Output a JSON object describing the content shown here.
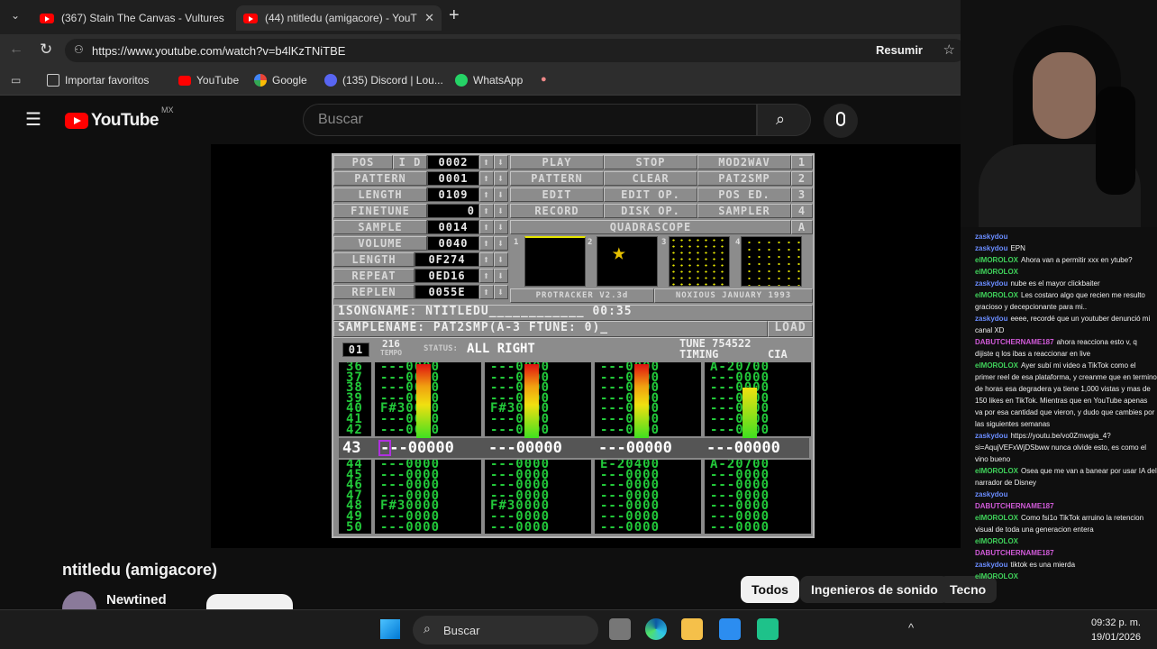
{
  "browser": {
    "tabs": [
      {
        "label": "(367) Stain The Canvas - Vultures (",
        "active": false
      },
      {
        "label": "(44) ntitledu (amigacore) - YouTub",
        "active": true
      }
    ],
    "new_tab": "+",
    "url": "https://www.youtube.com/watch?v=b4lKzTNiTBE",
    "summarize_label": "Resumir",
    "bookmarks": [
      "Importar favoritos",
      "YouTube",
      "Google",
      "(135) Discord | Lou...",
      "WhatsApp"
    ]
  },
  "youtube": {
    "logo_text": "YouTube",
    "country_code": "MX",
    "search_placeholder": "Buscar",
    "video_title": "ntitledu (amigacore)",
    "channel_name": "Newtined",
    "chips": [
      "Todos",
      "Ingenieros de sonido",
      "Tecno"
    ]
  },
  "tracker": {
    "labels_left": [
      "POS",
      "PATTERN",
      "LENGTH",
      "FINETUNE",
      "SAMPLE",
      "VOLUME",
      "LENGTH",
      "REPEAT",
      "REPLEN"
    ],
    "pos_flags": "I D",
    "values_left": [
      "0002",
      "0001",
      "0109",
      "0",
      "0014",
      "0040",
      "0F274",
      "0ED16",
      "0055E"
    ],
    "menu_rows": [
      [
        "PLAY",
        "STOP",
        "MOD2WAV",
        "1"
      ],
      [
        "PATTERN",
        "CLEAR",
        "PAT2SMP",
        "2"
      ],
      [
        "EDIT",
        "EDIT OP.",
        "POS ED.",
        "3"
      ],
      [
        "RECORD",
        "DISK OP.",
        "SAMPLER",
        "4"
      ]
    ],
    "quadrascope": "QUADRASCOPE",
    "quadrascope_key": "A",
    "scope_numbers": [
      "1",
      "2",
      "3",
      "4"
    ],
    "version_text": "PROTRACKER V2.3d",
    "credit_text": "NOXIOUS JANUARY 1993",
    "songname_line": "1SONGNAME:  NTITLEDU____________  00:35",
    "samplename_line": "SAMPLENAME:  PAT2SMP(A-3 FTUNE: 0)_",
    "load_label": "LOAD",
    "track_number": "01",
    "tempo_value": "216",
    "tempo_label": "TEMPO",
    "status_label": "STATUS:",
    "status_text": "ALL RIGHT",
    "tune_text": "TUNE 754522",
    "timing_label": "TIMING",
    "timing_value": "CIA",
    "row_numbers_top": "36\n37\n38\n39\n40\n41\n42",
    "row_numbers_bottom": "44\n45\n46\n47\n48\n49\n50",
    "current_row": "43",
    "channels_top": [
      "---0000\n---0000\n---0000\n---0000\nF#30000\n---0000\n---0000",
      "---0000\n---0000\n---0000\n---0000\nF#30000\n---0000\n---0000",
      "---0000\n---0000\n---0000\n---0000\n---0000\n---0000\n---0000",
      "A-20700\n---0000\n---0000\n---0000\n---0000\n---0000\n---0000"
    ],
    "channels_current": [
      "---00000",
      "---00000",
      "---00000",
      "---00000"
    ],
    "channels_bottom": [
      "---0000\n---0000\n---0000\n---0000\nF#30000\n---0000\n---0000",
      "---0000\n---0000\n---0000\n---0000\nF#30000\n---0000\n---0000",
      "E-20400\n---0000\n---0000\n---0000\n---0000\n---0000\n---0000",
      "A-20700\n---0000\n---0000\n---0000\n---0000\n---0000\n---0000"
    ]
  },
  "chat": [
    {
      "user": "zaskydou",
      "color": "#6a8cff",
      "msg": ""
    },
    {
      "user": "zaskydou",
      "color": "#6a8cff",
      "msg": "EPN"
    },
    {
      "user": "elMOROLOX",
      "color": "#3fd15a",
      "msg": "Ahora van a permitir xxx en ytube?"
    },
    {
      "user": "elMOROLOX",
      "color": "#3fd15a",
      "msg": ""
    },
    {
      "user": "zaskydou",
      "color": "#6a8cff",
      "msg": "nube es el mayor clickbaiter"
    },
    {
      "user": "elMOROLOX",
      "color": "#3fd15a",
      "msg": "Les costaro algo que recien me resulto gracioso y decepcionante para mi.."
    },
    {
      "user": "zaskydou",
      "color": "#6a8cff",
      "msg": "eeee, recordé que un youtuber denunció mi canal XD"
    },
    {
      "user": "DABUTCHERNAME187",
      "color": "#d05ad8",
      "msg": "ahora reacciona esto v, q dijiste q los ibas a reaccionar en live"
    },
    {
      "user": "elMOROLOX",
      "color": "#3fd15a",
      "msg": "Ayer subí mi video a TikTok como el primer reel de esa plataforma, y creanme que en termino de horas esa degradera ya tiene 1,000 vistas y mas de 150 likes en TikTok. Mientras que en YouTube apenas va por esa cantidad que vieron, y dudo que cambies por las siguientes semanas"
    },
    {
      "user": "zaskydou",
      "color": "#6a8cff",
      "msg": "https://youtu.be/vo0Zmwgia_4?si=AqujVEFxWjDSbww nunca olvide esto, es como el vino bueno"
    },
    {
      "user": "elMOROLOX",
      "color": "#3fd15a",
      "msg": "Osea que me van a banear por usar IA del narrador de Disney"
    },
    {
      "user": "zaskydou",
      "color": "#6a8cff",
      "msg": ""
    },
    {
      "user": "DABUTCHERNAME187",
      "color": "#d05ad8",
      "msg": ""
    },
    {
      "user": "elMOROLOX",
      "color": "#3fd15a",
      "msg": "Como fsi1o TikTok arruino la retencion visual de toda una generacion entera"
    },
    {
      "user": "elMOROLOX",
      "color": "#3fd15a",
      "msg": ""
    },
    {
      "user": "DABUTCHERNAME187",
      "color": "#d05ad8",
      "msg": ""
    },
    {
      "user": "zaskydou",
      "color": "#6a8cff",
      "msg": "tiktok es una mierda"
    },
    {
      "user": "elMOROLOX",
      "color": "#3fd15a",
      "msg": ""
    }
  ],
  "taskbar": {
    "search_placeholder": "Buscar",
    "time": "09:32 p. m.",
    "date": "19/01/2026"
  }
}
